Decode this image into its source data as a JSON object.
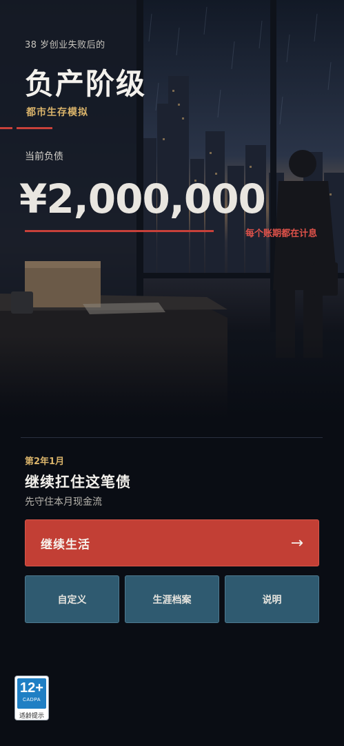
{
  "hero": {
    "kicker": "38 岁创业失败后的",
    "title": "负产阶级",
    "subtitle": "都市生存模拟",
    "debt_label": "当前负债",
    "debt_amount": "¥2,000,000",
    "interest_note": "每个账期都在计息"
  },
  "turn": {
    "date_label": "第2年1月",
    "title": "继续扛住这笔债",
    "subtitle": "先守住本月现金流"
  },
  "actions": {
    "primary_label": "继续生活",
    "primary_arrow": "→",
    "secondary": [
      "自定义",
      "生涯档案",
      "说明"
    ]
  },
  "rating": {
    "age": "12+",
    "org": "CADPA",
    "tip": "适龄提示"
  },
  "colors": {
    "accent_red": "#c23f35",
    "gold": "#d9b36a",
    "secondary_button": "#2f5a70",
    "background": "#0a0d14"
  }
}
